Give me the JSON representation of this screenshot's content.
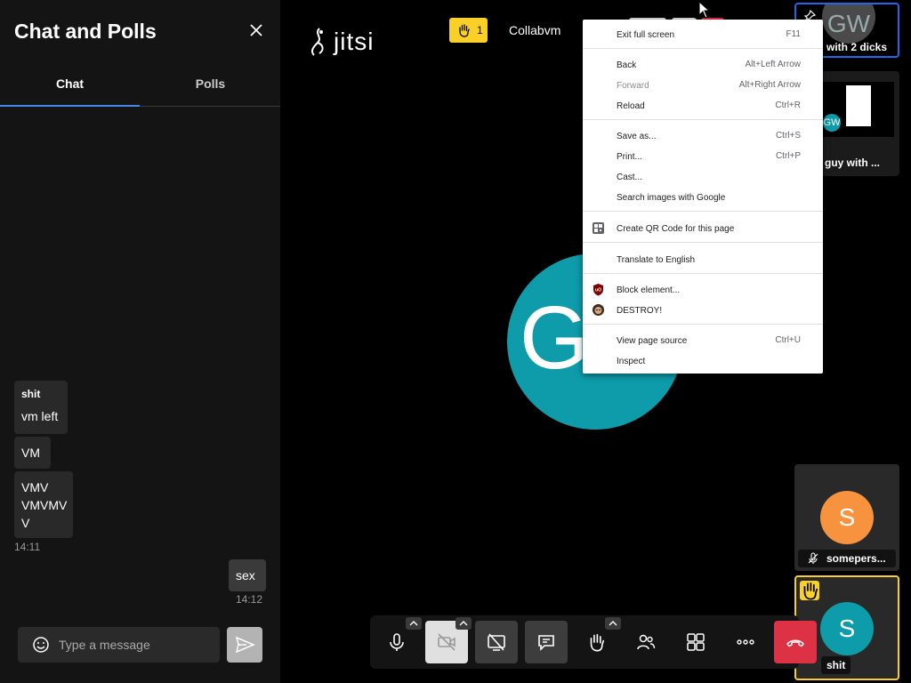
{
  "sidebar": {
    "title": "Chat and Polls",
    "tabs": [
      {
        "label": "Chat"
      },
      {
        "label": "Polls"
      }
    ],
    "messages": [
      {
        "sender": "shit",
        "lines": [
          "vm left"
        ]
      },
      {
        "lines": [
          "VM"
        ]
      },
      {
        "lines": [
          "VMV",
          "VMVMV",
          "V"
        ],
        "time": "14:11"
      },
      {
        "lines": [
          "sex"
        ],
        "time": "14:12",
        "own": true
      }
    ],
    "composer": {
      "placeholder": "Type a message"
    }
  },
  "header": {
    "logo_text": "jitsi",
    "raised_hands_count": "1",
    "room_name": "Collabvm"
  },
  "stage": {
    "avatar_initials": "G",
    "avatar_color": "#0e9cab"
  },
  "filmstrip": [
    {
      "initials": "GW",
      "name": "with 2 dicks"
    },
    {
      "initials": "GW",
      "name": "guy with ..."
    },
    {
      "initials": "S",
      "name": "somepers...",
      "color": "#f7933f"
    },
    {
      "initials": "S",
      "name": "shit",
      "color": "#0e9cab"
    }
  ],
  "toolbar": {
    "buttons": [
      "mic-icon",
      "camera-off-icon",
      "screenshare-off-icon",
      "chat-icon",
      "raise-hand-icon",
      "participants-icon",
      "tile-view-icon",
      "more-icon",
      "hangup-icon"
    ]
  },
  "context_menu": {
    "items": [
      {
        "label": "Exit full screen",
        "shortcut": "F11"
      },
      {
        "label": "Back",
        "shortcut": "Alt+Left Arrow"
      },
      {
        "label": "Forward",
        "shortcut": "Alt+Right Arrow",
        "disabled": true
      },
      {
        "label": "Reload",
        "shortcut": "Ctrl+R"
      },
      {
        "label": "Save as...",
        "shortcut": "Ctrl+S"
      },
      {
        "label": "Print...",
        "shortcut": "Ctrl+P"
      },
      {
        "label": "Cast..."
      },
      {
        "label": "Search images with Google"
      },
      {
        "label": "Create QR Code for this page"
      },
      {
        "label": "Translate to English"
      },
      {
        "label": "Block element..."
      },
      {
        "label": "DESTROY!"
      },
      {
        "label": "View page source",
        "shortcut": "Ctrl+U"
      },
      {
        "label": "Inspect"
      }
    ]
  },
  "colors": {
    "accent": "#4687ed",
    "raise_hand": "#f8d027",
    "hangup": "#dd3145",
    "pinned_border": "#1e6aeb"
  }
}
